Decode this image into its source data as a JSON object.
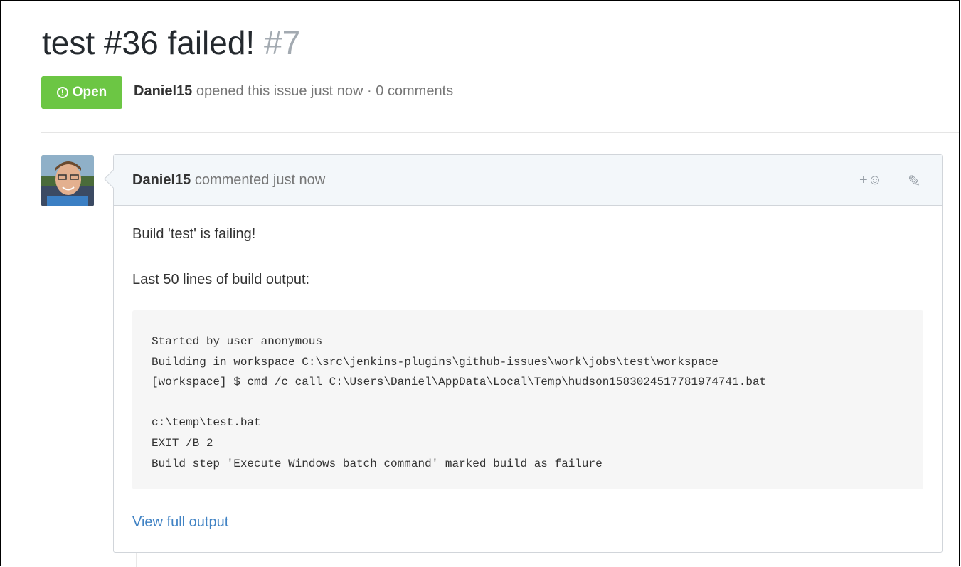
{
  "issue": {
    "title": "test #36 failed!",
    "number": "#7",
    "status": "Open",
    "author": "Daniel15",
    "meta_text": "opened this issue just now · 0 comments"
  },
  "comment": {
    "author": "Daniel15",
    "time_text": "commented just now",
    "reaction_label": "+",
    "body": {
      "line1": "Build 'test' is failing!",
      "line2": "Last 50 lines of build output:",
      "code": "Started by user anonymous\nBuilding in workspace C:\\src\\jenkins-plugins\\github-issues\\work\\jobs\\test\\workspace\n[workspace] $ cmd /c call C:\\Users\\Daniel\\AppData\\Local\\Temp\\hudson1583024517781974741.bat\n\nc:\\temp\\test.bat\nEXIT /B 2\nBuild step 'Execute Windows batch command' marked build as failure",
      "link_text": "View full output"
    }
  },
  "colors": {
    "open_green": "#6cc644",
    "link_blue": "#4183c4",
    "header_bg": "#f3f7fa",
    "code_bg": "#f6f6f6"
  },
  "icons": {
    "status": "issue-opened-icon",
    "reaction": "smiley-icon",
    "edit": "pencil-icon"
  }
}
